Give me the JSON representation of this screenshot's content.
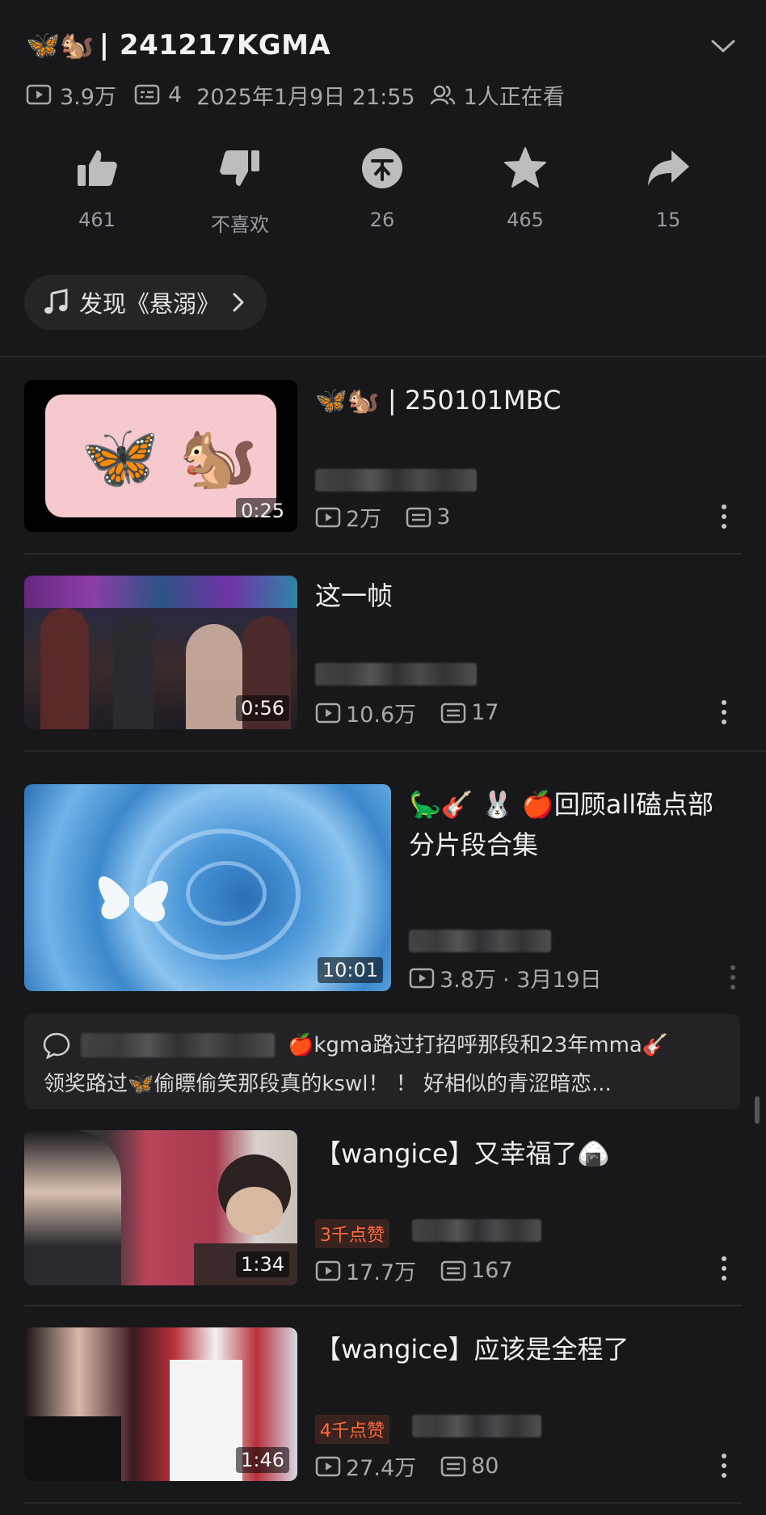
{
  "header": {
    "title_emoji": "🦋🐿️",
    "title": "| 241217KGMA",
    "views": "3.9万",
    "danmaku": "4",
    "datetime": "2025年1月9日 21:55",
    "watching": "1人正在看"
  },
  "actions": {
    "like": "461",
    "dislike": "不喜欢",
    "coin": "26",
    "favorite": "465",
    "share": "15"
  },
  "music": {
    "label": "发现《悬溺》"
  },
  "videos": [
    {
      "title": "🦋🐿️ | 250101MBC",
      "duration": "0:25",
      "views": "2万",
      "danmaku": "3"
    },
    {
      "title": "这一帧",
      "duration": "0:56",
      "views": "10.6万",
      "danmaku": "17"
    },
    {
      "title_line1": "🦕🎸 🐰 🍎回顾all磕点部",
      "title_line2": "分片段合集",
      "duration": "10:01",
      "views": "3.8万",
      "date": "· 3月19日"
    },
    {
      "title": "【wangice】又幸福了🍙",
      "badge": "3千点赞",
      "duration": "1:34",
      "views": "17.7万",
      "danmaku": "167"
    },
    {
      "title": "【wangice】应该是全程了",
      "badge": "4千点赞",
      "duration": "1:46",
      "views": "27.4万",
      "danmaku": "80"
    }
  ],
  "comment": {
    "line1": "🍎kgma路过打招呼那段和23年mma🎸",
    "line2": "领奖路过🦋偷瞟偷笑那段真的kswl！ ！ 好相似的青涩暗恋..."
  }
}
